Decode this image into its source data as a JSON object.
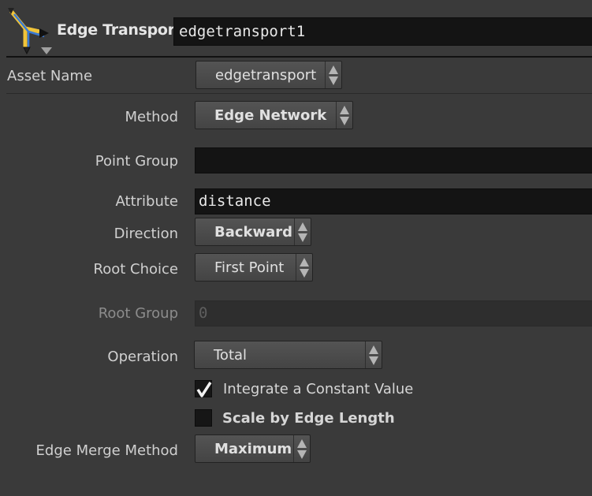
{
  "header": {
    "node_type": "Edge Transport",
    "node_name": "edgetransport1"
  },
  "colors": {
    "icon_yellow": "#f0c43a",
    "icon_blue": "#3a7bd5"
  },
  "params": {
    "asset_name": {
      "label": "Asset Name",
      "value": "edgetransport"
    },
    "method": {
      "label": "Method",
      "value": "Edge Network"
    },
    "point_group": {
      "label": "Point Group",
      "value": ""
    },
    "attribute": {
      "label": "Attribute",
      "value": "distance"
    },
    "direction": {
      "label": "Direction",
      "value": "Backward"
    },
    "root_choice": {
      "label": "Root Choice",
      "value": "First Point"
    },
    "root_group": {
      "label": "Root Group",
      "value": "0"
    },
    "operation": {
      "label": "Operation",
      "value": "Total"
    },
    "integrate": {
      "label": "Integrate a Constant Value",
      "checked": true
    },
    "scale_by_edge": {
      "label": "Scale by Edge Length",
      "checked": false
    },
    "edge_merge": {
      "label": "Edge Merge Method",
      "value": "Maximum"
    }
  }
}
